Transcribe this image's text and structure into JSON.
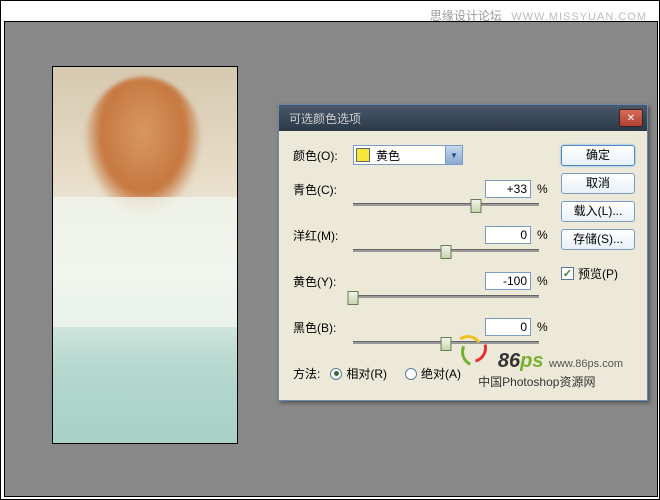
{
  "watermark": {
    "site_cn": "思缘设计论坛",
    "site_en": "WWW.MISSYUAN.COM"
  },
  "dialog": {
    "title": "可选颜色选项",
    "color_label": "颜色(O):",
    "color_selected": "黄色",
    "color_swatch": "#f5e63a",
    "sliders": {
      "cyan": {
        "label": "青色(C):",
        "value": "+33",
        "unit": "%",
        "pos": 66
      },
      "magenta": {
        "label": "洋红(M):",
        "value": "0",
        "unit": "%",
        "pos": 50
      },
      "yellow": {
        "label": "黄色(Y):",
        "value": "-100",
        "unit": "%",
        "pos": 0
      },
      "black": {
        "label": "黑色(B):",
        "value": "0",
        "unit": "%",
        "pos": 50
      }
    },
    "method": {
      "label": "方法:",
      "relative": "相对(R)",
      "absolute": "绝对(A)"
    },
    "buttons": {
      "ok": "确定",
      "cancel": "取消",
      "load": "载入(L)...",
      "save": "存储(S)..."
    },
    "preview": "预览(P)"
  },
  "logo": {
    "brand": "86",
    "brand_suffix": "ps",
    "url": "www.86ps.com",
    "tagline": "中国Photoshop资源网"
  }
}
